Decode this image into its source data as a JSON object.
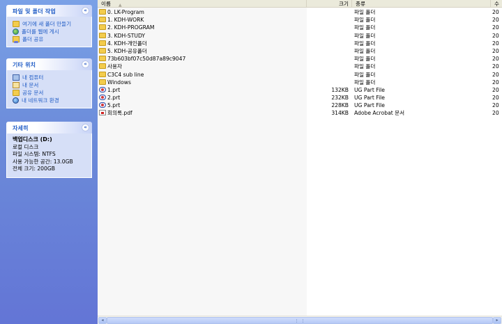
{
  "task_pane": {
    "file_tasks": {
      "title": "파일 및 폴더 작업",
      "items": [
        {
          "label": "여기에 새 폴더 만들기",
          "icon": "new-folder-icon"
        },
        {
          "label": "폴더를 웹에 게시",
          "icon": "publish-web-icon"
        },
        {
          "label": "폴더 공유",
          "icon": "share-folder-icon"
        }
      ]
    },
    "other_places": {
      "title": "기타 위치",
      "items": [
        {
          "label": "내 컴퓨터",
          "icon": "my-computer-icon"
        },
        {
          "label": "내 문서",
          "icon": "my-documents-icon"
        },
        {
          "label": "공유 문서",
          "icon": "shared-documents-icon"
        },
        {
          "label": "내 네트워크 환경",
          "icon": "network-places-icon"
        }
      ]
    },
    "details": {
      "title": "자세히",
      "drive_name": "백업디스크 (D:)",
      "drive_type": "로컬 디스크",
      "filesystem": "파일 시스템: NTFS",
      "free_space": "사용 가능한 공간: 13.0GB",
      "total_size": "전체 크기: 200GB"
    },
    "collapse_glyph": "«"
  },
  "list": {
    "columns": {
      "name": "이름",
      "size": "크기",
      "type": "종류",
      "modified": "수"
    },
    "sort_glyph": "▲",
    "rows": [
      {
        "icon": "folder",
        "name": "0. LK-Program",
        "size": "",
        "type": "파일 폴더",
        "mod": "20"
      },
      {
        "icon": "folder",
        "name": "1. KDH-WORK",
        "size": "",
        "type": "파일 폴더",
        "mod": "20"
      },
      {
        "icon": "folder",
        "name": "2. KDH-PROGRAM",
        "size": "",
        "type": "파일 폴더",
        "mod": "20"
      },
      {
        "icon": "folder",
        "name": "3. KDH-STUDY",
        "size": "",
        "type": "파일 폴더",
        "mod": "20"
      },
      {
        "icon": "folder",
        "name": "4. KDH-개인폴더",
        "size": "",
        "type": "파일 폴더",
        "mod": "20"
      },
      {
        "icon": "folder",
        "name": "5. KDH-공유폴더",
        "size": "",
        "type": "파일 폴더",
        "mod": "20"
      },
      {
        "icon": "folder",
        "name": "73b603bf07c50d87a89c9047",
        "size": "",
        "type": "파일 폴더",
        "mod": "20"
      },
      {
        "icon": "folder",
        "name": "사용자",
        "size": "",
        "type": "파일 폴더",
        "mod": "20"
      },
      {
        "icon": "folder",
        "name": "C3C4 sub line",
        "size": "",
        "type": "파일 폴더",
        "mod": "20"
      },
      {
        "icon": "folder",
        "name": "Windows",
        "size": "",
        "type": "파일 폴더",
        "mod": "20"
      },
      {
        "icon": "prt",
        "name": "1.prt",
        "size": "132KB",
        "type": "UG Part File",
        "mod": "20"
      },
      {
        "icon": "prt",
        "name": "2.prt",
        "size": "232KB",
        "type": "UG Part File",
        "mod": "20"
      },
      {
        "icon": "prt",
        "name": "5.prt",
        "size": "228KB",
        "type": "UG Part File",
        "mod": "20"
      },
      {
        "icon": "pdf",
        "name": "회의록.pdf",
        "size": "314KB",
        "type": "Adobe Acrobat 문서",
        "mod": "20"
      }
    ]
  },
  "scrollbar": {
    "left_glyph": "◂",
    "right_glyph": "▸"
  }
}
